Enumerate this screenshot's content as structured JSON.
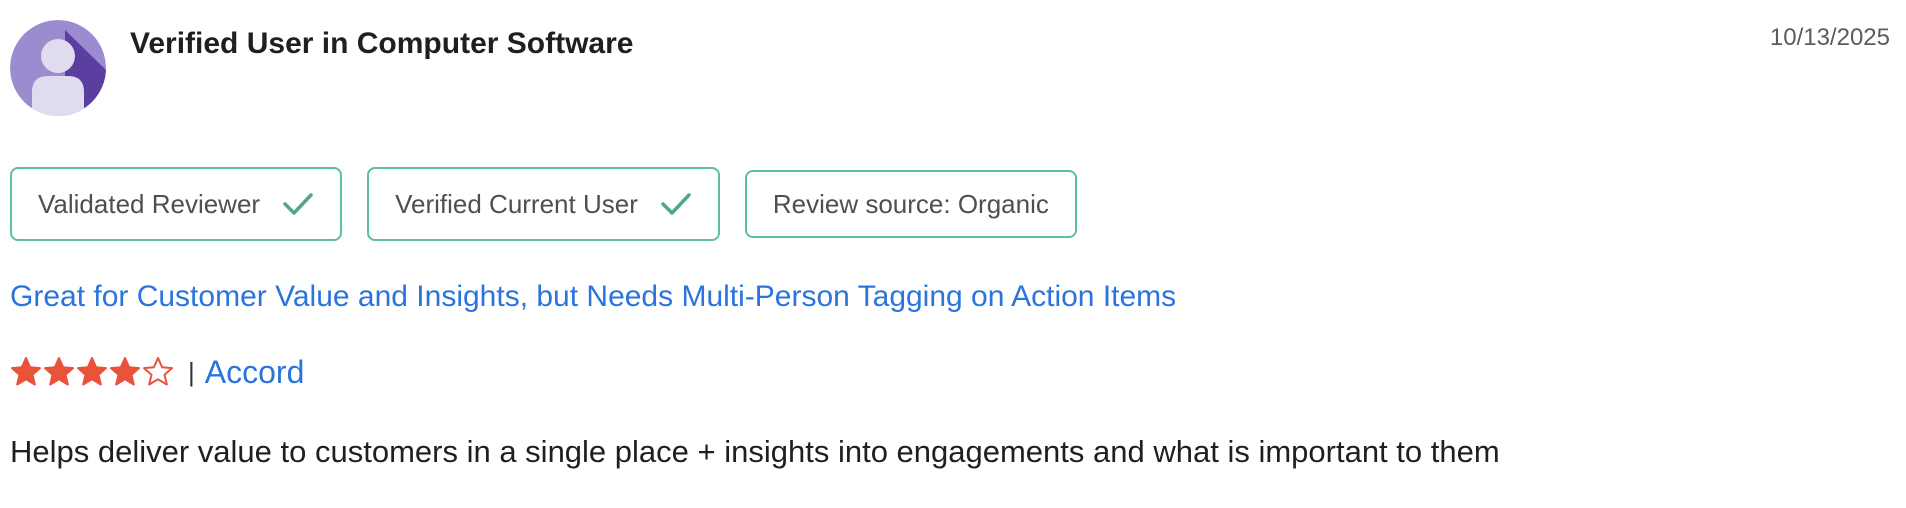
{
  "reviewer": {
    "name": "Verified User in Computer Software",
    "avatar_icon": "user-avatar-icon"
  },
  "date": "10/13/2025",
  "badges": [
    {
      "label": "Validated Reviewer",
      "icon": "check-icon"
    },
    {
      "label": "Verified Current User",
      "icon": "check-icon"
    },
    {
      "label": "Review source: Organic"
    }
  ],
  "review": {
    "title": "Great for Customer Value and Insights, but Needs Multi-Person Tagging on Action Items",
    "rating": 4,
    "rating_max": 5,
    "separator": "|",
    "product": "Accord",
    "body": "Helps deliver value to customers in a single place + insights into engagements and what is important to them"
  },
  "colors": {
    "avatar_light": "#9b8cd0",
    "avatar_dark": "#5a3fa0",
    "badge_border": "#5cbfa0",
    "check": "#4ba98a",
    "link": "#2b74de",
    "star": "#e8533a"
  }
}
